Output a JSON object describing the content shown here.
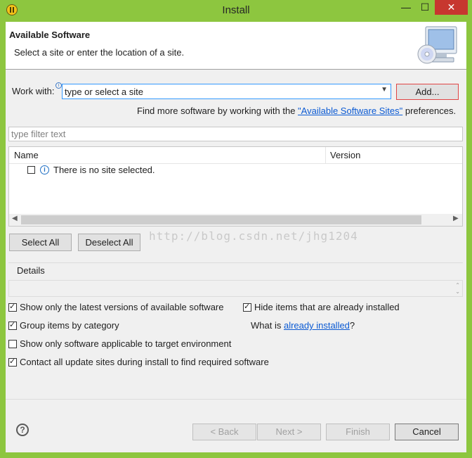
{
  "window": {
    "title": "Install",
    "min_glyph": "—",
    "max_glyph": "☐",
    "close_glyph": "✕"
  },
  "banner": {
    "title": "Available Software",
    "description": "Select a site or enter the location of a site."
  },
  "work_with": {
    "label": "Work with:",
    "info_glyph": "i",
    "value": "type or select a site",
    "add_label": "Add..."
  },
  "find_more": {
    "prefix": "Find more software by working with the ",
    "link": "\"Available Software Sites\"",
    "suffix": " preferences."
  },
  "filter": {
    "placeholder": "type filter text"
  },
  "table": {
    "columns": [
      "Name",
      "Version"
    ],
    "rows": [
      {
        "checked": false,
        "info_glyph": "i",
        "text": "There is no site selected."
      }
    ],
    "scroll_left": "◀",
    "scroll_right": "▶"
  },
  "selection": {
    "select_all": "Select All",
    "deselect_all": "Deselect All"
  },
  "watermark": "http://blog.csdn.net/jhg1204",
  "details": {
    "label": "Details",
    "spin_up": "⌃",
    "spin_down": "⌄"
  },
  "options": {
    "latest_versions": {
      "label": "Show only the latest versions of available software",
      "checked": true
    },
    "hide_installed": {
      "label": "Hide items that are already installed",
      "checked": true
    },
    "group_by_category": {
      "label": "Group items by category",
      "checked": true
    },
    "what_is_prefix": "What is ",
    "what_is_link": "already installed",
    "what_is_suffix": "?",
    "target_env": {
      "label": "Show only software applicable to target environment",
      "checked": false
    },
    "contact_sites": {
      "label": "Contact all update sites during install to find required software",
      "checked": true
    }
  },
  "footer": {
    "help_glyph": "?",
    "back": "< Back",
    "next": "Next >",
    "finish": "Finish",
    "cancel": "Cancel"
  }
}
